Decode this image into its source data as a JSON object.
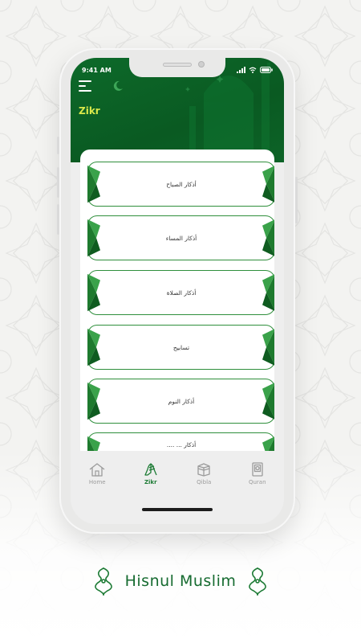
{
  "status_bar": {
    "time": "9:41 AM"
  },
  "header": {
    "title": "Zikr"
  },
  "zikr_list": {
    "items": [
      {
        "label": "أذكار الصباح"
      },
      {
        "label": "أذكار المساء"
      },
      {
        "label": "أذكار الصلاة"
      },
      {
        "label": "تسابيح"
      },
      {
        "label": "أذكار النوم"
      },
      {
        "label": "أذكار ... ...."
      }
    ]
  },
  "tab_bar": {
    "tabs": [
      {
        "label": "Home",
        "icon": "home-icon",
        "active": false
      },
      {
        "label": "Zikr",
        "icon": "praying-hands-icon",
        "active": true
      },
      {
        "label": "Qibla",
        "icon": "kaaba-icon",
        "active": false
      },
      {
        "label": "Quran",
        "icon": "quran-book-icon",
        "active": false
      }
    ]
  },
  "brand": {
    "name": "Hisnul Muslim"
  },
  "colors": {
    "primary_green": "#0a5a22",
    "accent_yellow": "#d9e84a",
    "item_border": "#2f8f3c",
    "active_tab": "#1d7b35"
  }
}
